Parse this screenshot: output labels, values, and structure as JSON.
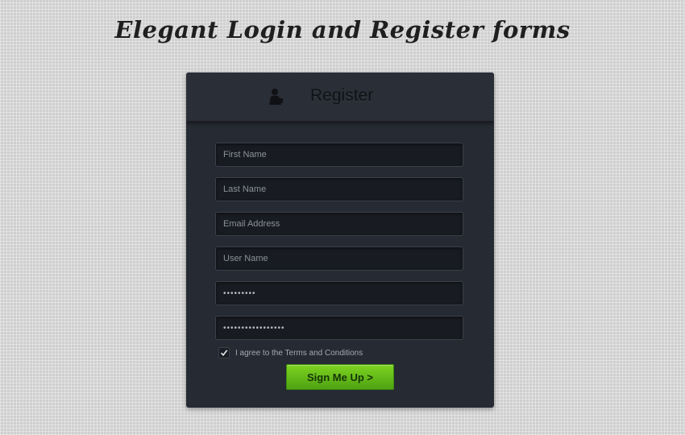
{
  "page": {
    "title": "Elegant Login and Register forms"
  },
  "register": {
    "header_title": "Register",
    "header_icon": "user-silhouette-icon",
    "fields": {
      "first_name_placeholder": "First Name",
      "last_name_placeholder": "Last Name",
      "email_placeholder": "Email Address",
      "username_placeholder": "User Name",
      "password_value": "•••••••••",
      "confirm_password_value": "•••••••••••••••••"
    },
    "terms": {
      "checked": true,
      "label": "I agree to the Terms and Conditions"
    },
    "submit_label": "Sign Me Up >"
  },
  "colors": {
    "card_background": "#262a33",
    "button_green": "#6cc11b",
    "page_background": "#cfcfcf"
  }
}
